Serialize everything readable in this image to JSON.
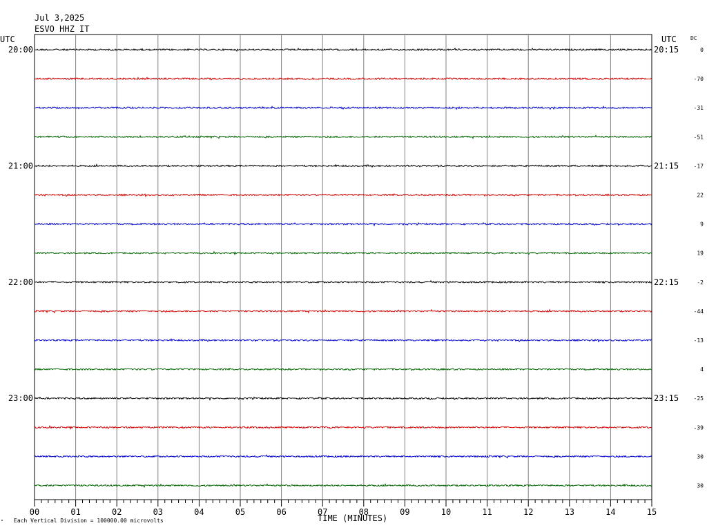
{
  "header": {
    "date": "Jul 3,2025",
    "station": "ESVO HHZ IT"
  },
  "utc_left": "UTC",
  "utc_right": "UTC",
  "dc_header": "DC",
  "footer": {
    "mark": "\"",
    "scale_note": "Each Vertical Division = 100000.00 microvolts"
  },
  "chart_data": {
    "type": "line",
    "xlabel": "TIME (MINUTES)",
    "xlim": [
      0,
      15
    ],
    "x_ticks": [
      "00",
      "01",
      "02",
      "03",
      "04",
      "05",
      "06",
      "07",
      "08",
      "09",
      "10",
      "11",
      "12",
      "13",
      "14",
      "15"
    ],
    "rows": [
      {
        "left": "20:00",
        "right": "20:15",
        "dc": "0",
        "color": "#000000"
      },
      {
        "left": "",
        "right": "",
        "dc": "-70",
        "color": "#d00000"
      },
      {
        "left": "",
        "right": "",
        "dc": "-31",
        "color": "#0000cc"
      },
      {
        "left": "",
        "right": "",
        "dc": "-51",
        "color": "#006400"
      },
      {
        "left": "21:00",
        "right": "21:15",
        "dc": "-17",
        "color": "#000000"
      },
      {
        "left": "",
        "right": "",
        "dc": "22",
        "color": "#d00000"
      },
      {
        "left": "",
        "right": "",
        "dc": "9",
        "color": "#0000cc"
      },
      {
        "left": "",
        "right": "",
        "dc": "19",
        "color": "#006400"
      },
      {
        "left": "22:00",
        "right": "22:15",
        "dc": "-2",
        "color": "#000000"
      },
      {
        "left": "",
        "right": "",
        "dc": "-44",
        "color": "#d00000"
      },
      {
        "left": "",
        "right": "",
        "dc": "-13",
        "color": "#0000cc"
      },
      {
        "left": "",
        "right": "",
        "dc": "4",
        "color": "#006400"
      },
      {
        "left": "23:00",
        "right": "23:15",
        "dc": "-25",
        "color": "#000000"
      },
      {
        "left": "",
        "right": "",
        "dc": "-39",
        "color": "#d00000"
      },
      {
        "left": "",
        "right": "",
        "dc": "30",
        "color": "#0000cc"
      },
      {
        "left": "",
        "right": "",
        "dc": "30",
        "color": "#006400"
      }
    ]
  }
}
